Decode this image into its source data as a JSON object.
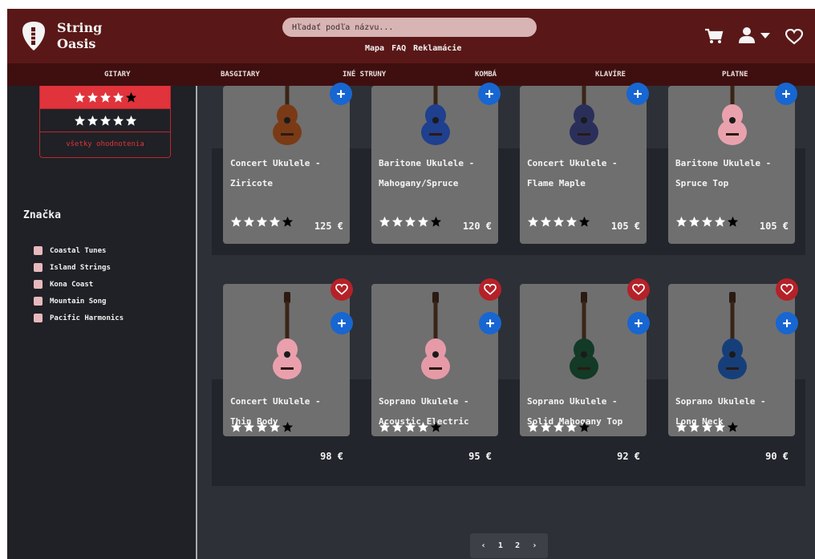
{
  "brand": {
    "name_line1": "String",
    "name_line2": "Oasis"
  },
  "search": {
    "placeholder": "Hľadať podľa názvu..."
  },
  "toplinks": [
    "Mapa",
    "FAQ",
    "Reklamácie"
  ],
  "nav": [
    "GITARY",
    "BASGITARY",
    "INÉ STRUNY",
    "KOMBÁ",
    "KLAVÍRE",
    "PLATNE"
  ],
  "sidebar": {
    "ratings": [
      {
        "value": 4,
        "of": 5,
        "active": true
      },
      {
        "value": 5,
        "of": 5,
        "active": false
      }
    ],
    "all_ratings_label": "všetky ohodnotenia",
    "brand_filter_title": "Značka",
    "brand_filters": [
      "Coastal Tunes",
      "Island Strings",
      "Kona Coast",
      "Mountain Song",
      "Pacific Harmonics"
    ]
  },
  "products_row1": [
    {
      "title": "Concert Ukulele - Ziricote",
      "price": "125 €",
      "rating": 4,
      "color": "#7a3a15"
    },
    {
      "title": "Baritone Ukulele - Mahogany/Spruce",
      "price": "120 €",
      "rating": 4,
      "color": "#1f3f8f"
    },
    {
      "title": "Concert Ukulele - Flame Maple",
      "price": "105 €",
      "rating": 4,
      "color": "#2a2f5a"
    },
    {
      "title": "Baritone Ukulele - Spruce Top",
      "price": "105 €",
      "rating": 4,
      "color": "#e9a2ad"
    }
  ],
  "products_row2": [
    {
      "title": "Concert Ukulele - Thin Body",
      "price": "98 €",
      "rating": 4,
      "color": "#eaa0ac"
    },
    {
      "title": "Soprano Ukulele - Acoustic Electric",
      "price": "95 €",
      "rating": 4,
      "color": "#e69aa7"
    },
    {
      "title": "Soprano Ukulele - Solid Mahogany Top",
      "price": "92 €",
      "rating": 4,
      "color": "#123a26"
    },
    {
      "title": "Soprano Ukulele - Long Neck",
      "price": "90 €",
      "rating": 4,
      "color": "#163f7a"
    }
  ],
  "pagination": {
    "prev": "‹",
    "pages": [
      "1",
      "2"
    ],
    "next": "›"
  },
  "colors": {
    "header": "#5a1717",
    "nav": "#3f0f0f",
    "accent_red": "#e0333b",
    "add_blue": "#1766d1",
    "fav_red": "#b52128"
  }
}
